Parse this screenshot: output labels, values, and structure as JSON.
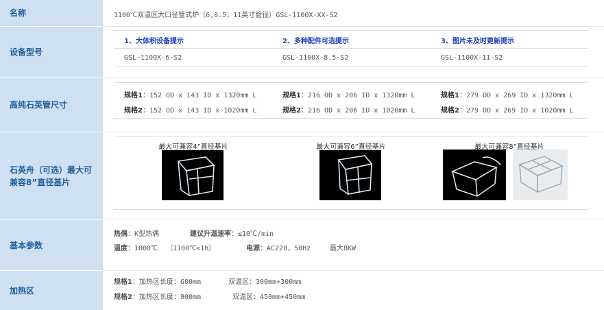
{
  "rows": {
    "name": {
      "label": "名称",
      "value": "1100℃双温区大口径管式炉（6,8.5，11英寸管径）GSL-1100X-XX-S2"
    },
    "model": {
      "label": "设备型号",
      "tips": [
        "1、大体积设备提示",
        "2、多种配件可选提示",
        "3、图片未及时更新提示"
      ],
      "models": [
        "GSL-1100X-6-S2",
        "GSL-1100X-8.5-S2",
        "GSL-1100X-11-S2"
      ]
    },
    "tube": {
      "label": "高纯石英管尺寸",
      "spec1_label": "规格1",
      "spec2_label": "规格2",
      "columns": [
        {
          "spec1": "：152 OD x 143 ID x 1320mm L",
          "spec2": "：152 OD x 143 ID x 1020mm L"
        },
        {
          "spec1": "：216 OD x 206 ID x 1320mm L",
          "spec2": "：216 OD x 206 ID x 1020mm L"
        },
        {
          "spec1": "：279 OD x 269 ID x 1320mm L",
          "spec2": "：279 OD x 269 ID x 1020mm L"
        }
      ]
    },
    "boat": {
      "label": "石英舟（可选）最大可兼容8”直径基片",
      "captions": [
        "最大可兼容4”直径基片",
        "最大可兼容6”直径基片",
        "最大可兼容8”直径基片"
      ]
    },
    "params": {
      "label": "基本参数",
      "thermocouple_label": "热偶",
      "thermocouple_value": "：K型热偶",
      "rate_label": "建议升温速率",
      "rate_value": "：≤10℃/min",
      "temp_label": "温度",
      "temp_value": "：1000℃  （1100℃<1h）",
      "power_label": "电源",
      "power_value": "：AC220，50Hz",
      "power_max": "最大8KW"
    },
    "heating": {
      "label": "加热区",
      "spec1_label": "规格1",
      "spec1_len": "：加热区长度：600mm",
      "spec1_dual": "双温区：300mm+300mm",
      "spec2_label": "规格2",
      "spec2_len": "：加热区长度：900mm",
      "spec2_dual": "双温区：450mm+450mm"
    }
  }
}
